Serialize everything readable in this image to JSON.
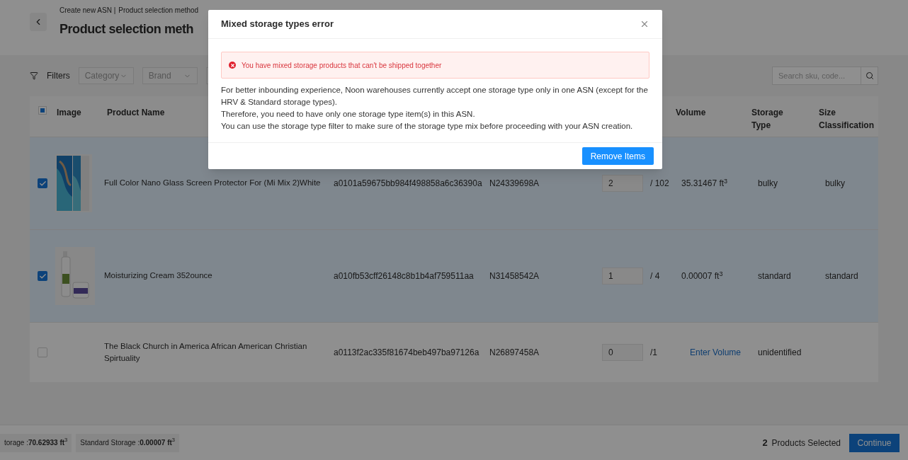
{
  "breadcrumb": [
    "Create new ASN |",
    "Product selection method"
  ],
  "page_title": "Product selection meth",
  "filters": {
    "label": "Filters",
    "dropdowns": [
      "Category",
      "Brand"
    ],
    "search": {
      "placeholder": "Search sku, code..."
    }
  },
  "table": {
    "header_checkbox": {
      "indeterminate": true
    },
    "columns": [
      {
        "label": "Image"
      },
      {
        "label": "Product Name"
      },
      {
        "label": "Volume"
      },
      {
        "label": "Storage Type"
      },
      {
        "label": "Size Classification"
      }
    ],
    "rows": [
      {
        "selected": true,
        "name": "Full Color Nano Glass Screen Protector For (Mi Mix 2)White",
        "sku": "a0101a59675bb984f498858a6c36390a",
        "code": "N24339698A",
        "quantity": "2",
        "available": "/ 102",
        "volume": {
          "kind": "value",
          "text": "35.31467 ft$^{3}$"
        },
        "storage_type": "bulky",
        "size_classification": "bulky"
      },
      {
        "selected": true,
        "name": "Moisturizing Cream 352ounce",
        "sku": "a010fb53cff26148c8b1b4af759511aa",
        "code": "N31458542A",
        "quantity": "1",
        "available": "/ 4",
        "volume": {
          "kind": "value",
          "text": "0.00007 ft$^{3}$"
        },
        "storage_type": "standard",
        "size_classification": "standard"
      },
      {
        "selected": false,
        "name": "The Black Church in America African American Christian Spirtuality",
        "sku": "a0113f2ac335f81674beb497ba97126a",
        "code": "N26897458A",
        "quantity": "0",
        "available": "/1",
        "volume": {
          "kind": "link",
          "text": "Enter Volume"
        },
        "storage_type": "unidentified"
      }
    ]
  },
  "footer": {
    "storage_chips": [
      "torage :**70.62933 ft**$^{3}$",
      "Standard Storage :**0.00007 ft**$^{3}$"
    ],
    "selected_count": "2",
    "selected_label": "Products Selected",
    "continue_button": "Continue"
  },
  "modal": {
    "title": "Mixed storage types error",
    "alert": "You have mixed storage products that can't be shipped together",
    "paragraphs": [
      "For better inbounding experience, Noon warehouses currently accept one storage type only in one ASN (except for the HRV & Standard storage types).",
      "Therefore, you need to have only one storage type item(s) in this ASN.",
      "You can use the storage type filter to make sure of the storage type mix before proceeding with your ASN creation."
    ],
    "button": "Remove Items"
  }
}
